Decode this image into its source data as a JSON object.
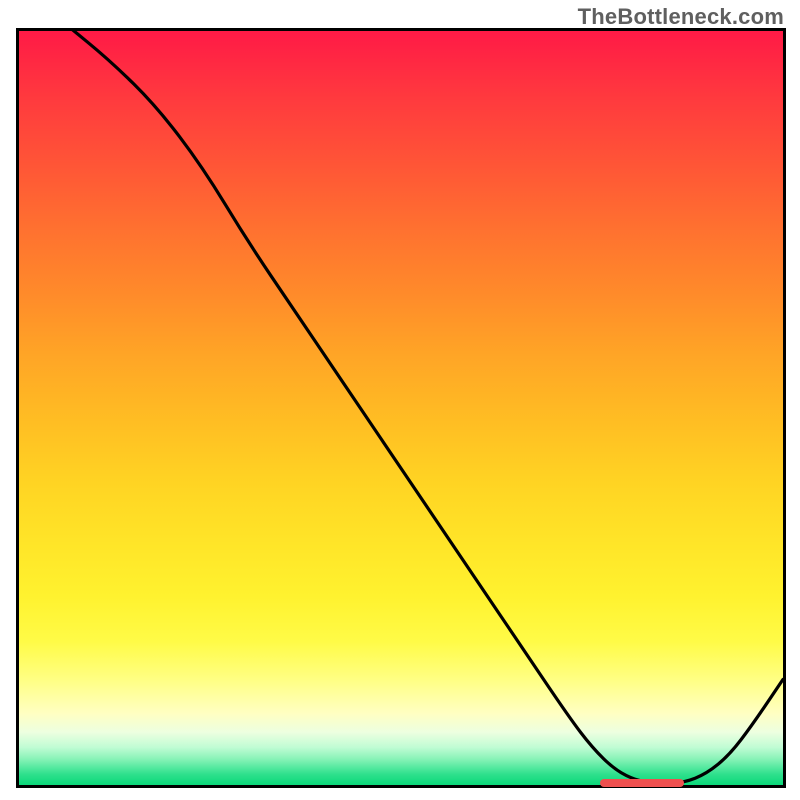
{
  "watermark": "TheBottleneck.com",
  "chart_data": {
    "type": "line",
    "title": "",
    "xlabel": "",
    "ylabel": "",
    "xlim": [
      0,
      100
    ],
    "ylim": [
      0,
      100
    ],
    "x": [
      0,
      6,
      12,
      18,
      24,
      30,
      36,
      42,
      48,
      54,
      60,
      66,
      72,
      75,
      78,
      81,
      84,
      87,
      90,
      93,
      96,
      100
    ],
    "values": [
      106,
      101,
      96,
      90,
      82,
      72,
      63,
      54,
      45,
      36,
      27,
      18,
      9,
      5,
      2,
      0.5,
      0.2,
      0.3,
      1.5,
      4,
      8,
      14
    ],
    "optimum_marker": {
      "x_start": 76,
      "x_end": 87,
      "y": 0
    },
    "background": "red-yellow-green vertical gradient (red top, green bottom)"
  }
}
